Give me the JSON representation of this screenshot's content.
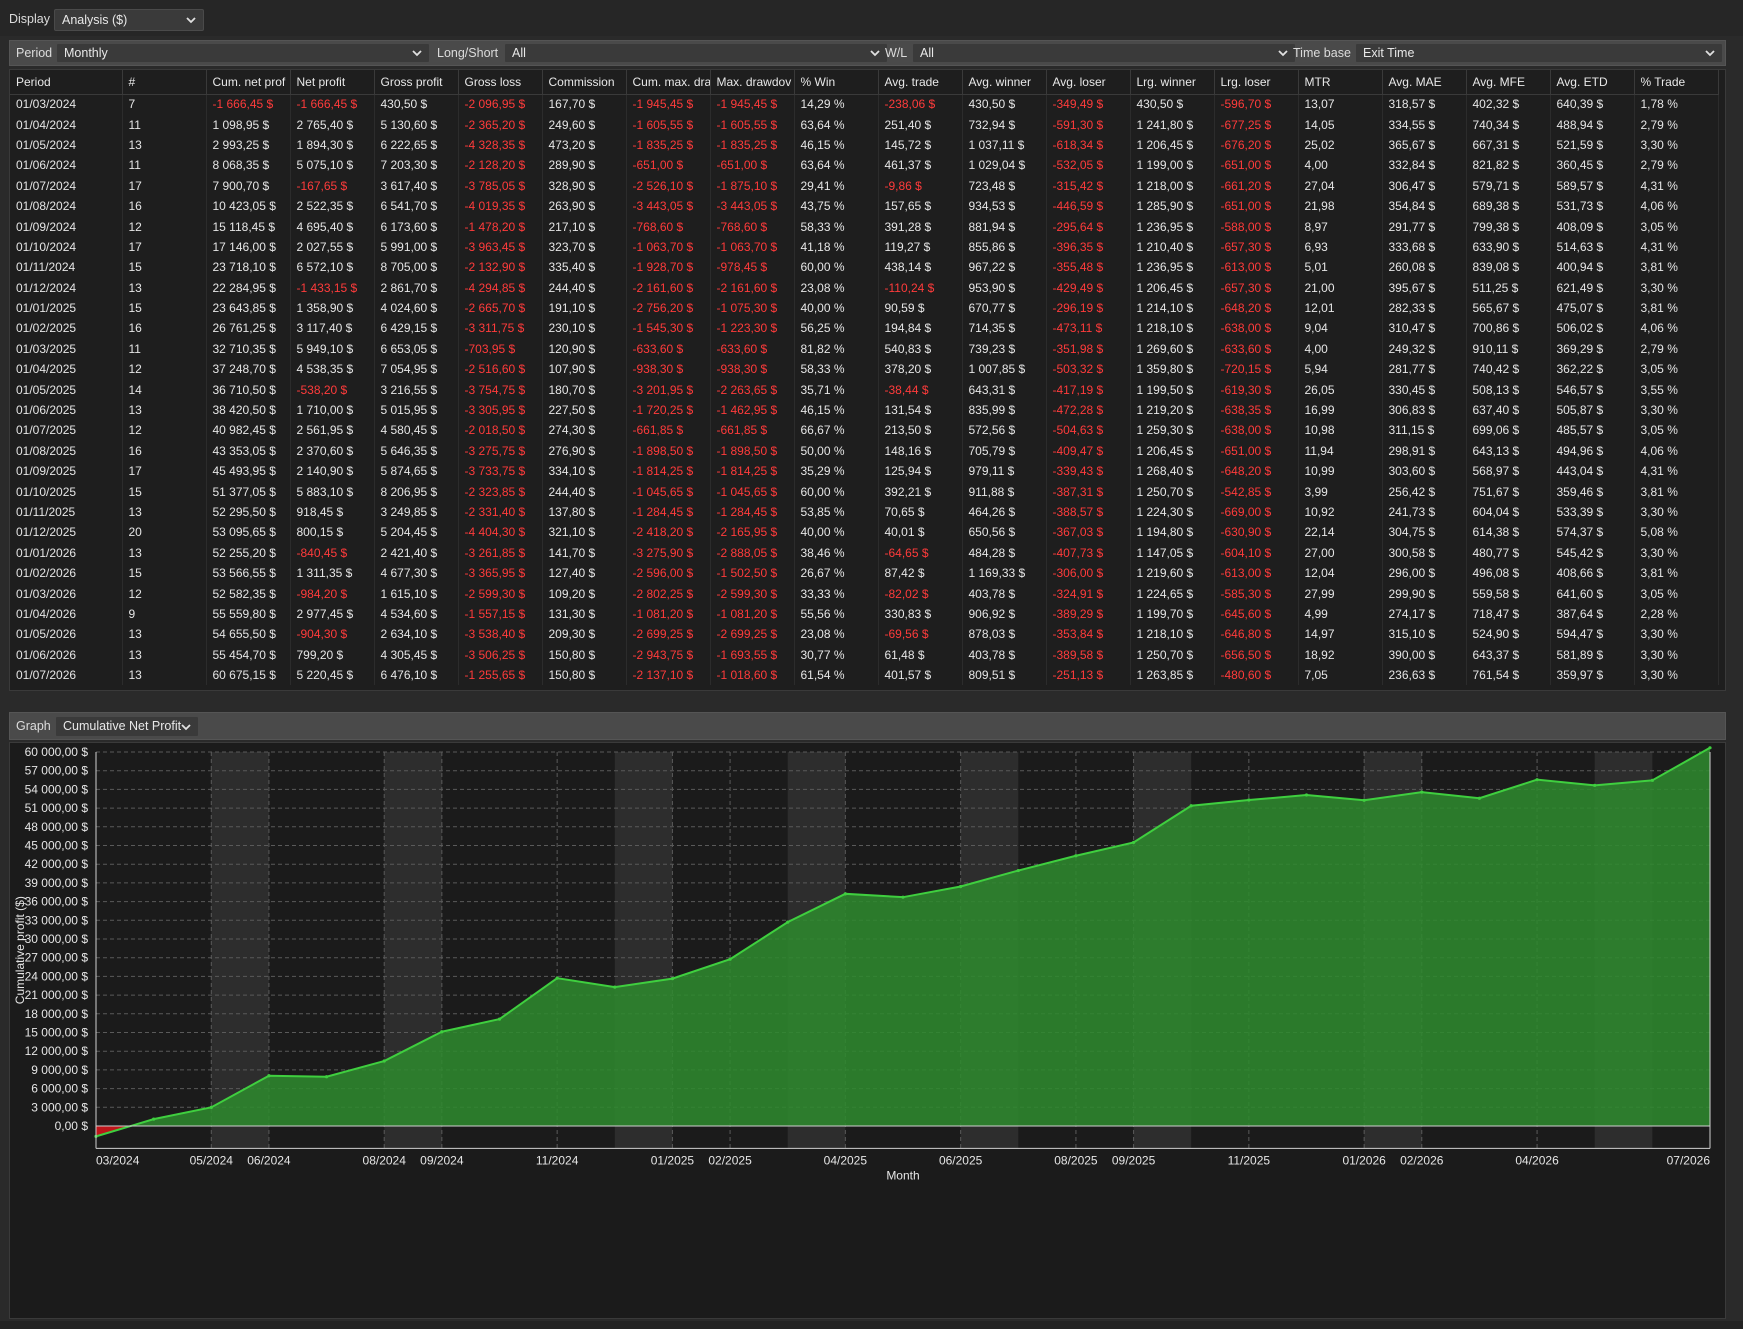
{
  "display": {
    "label": "Display",
    "value": "Analysis ($)"
  },
  "filters": [
    {
      "label": "Period",
      "value": "Monthly"
    },
    {
      "label": "Long/Short",
      "value": "All"
    },
    {
      "label": "W/L",
      "value": "All"
    },
    {
      "label": "Time base",
      "value": "Exit Time"
    }
  ],
  "table": {
    "columns": [
      "Period",
      "#",
      "Cum. net prof",
      "Net profit",
      "Gross profit",
      "Gross loss",
      "Commission",
      "Cum. max. dra",
      "Max. drawdov",
      "% Win",
      "Avg. trade",
      "Avg. winner",
      "Avg. loser",
      "Lrg. winner",
      "Lrg. loser",
      "MTR",
      "Avg. MAE",
      "Avg. MFE",
      "Avg. ETD",
      "% Trade"
    ],
    "rows": [
      [
        "01/03/2024",
        "7",
        "-1 666,45 $",
        "-1 666,45 $",
        "430,50 $",
        "-2 096,95 $",
        "167,70 $",
        "-1 945,45 $",
        "-1 945,45 $",
        "14,29 %",
        "-238,06 $",
        "430,50 $",
        "-349,49 $",
        "430,50 $",
        "-596,70 $",
        "13,07",
        "318,57 $",
        "402,32 $",
        "640,39 $",
        "1,78 %"
      ],
      [
        "01/04/2024",
        "11",
        "1 098,95 $",
        "2 765,40 $",
        "5 130,60 $",
        "-2 365,20 $",
        "249,60 $",
        "-1 605,55 $",
        "-1 605,55 $",
        "63,64 %",
        "251,40 $",
        "732,94 $",
        "-591,30 $",
        "1 241,80 $",
        "-677,25 $",
        "14,05",
        "334,55 $",
        "740,34 $",
        "488,94 $",
        "2,79 %"
      ],
      [
        "01/05/2024",
        "13",
        "2 993,25 $",
        "1 894,30 $",
        "6 222,65 $",
        "-4 328,35 $",
        "473,20 $",
        "-1 835,25 $",
        "-1 835,25 $",
        "46,15 %",
        "145,72 $",
        "1 037,11 $",
        "-618,34 $",
        "1 206,45 $",
        "-676,20 $",
        "25,02",
        "365,67 $",
        "667,31 $",
        "521,59 $",
        "3,30 %"
      ],
      [
        "01/06/2024",
        "11",
        "8 068,35 $",
        "5 075,10 $",
        "7 203,30 $",
        "-2 128,20 $",
        "289,90 $",
        "-651,00 $",
        "-651,00 $",
        "63,64 %",
        "461,37 $",
        "1 029,04 $",
        "-532,05 $",
        "1 199,00 $",
        "-651,00 $",
        "4,00",
        "332,84 $",
        "821,82 $",
        "360,45 $",
        "2,79 %"
      ],
      [
        "01/07/2024",
        "17",
        "7 900,70 $",
        "-167,65 $",
        "3 617,40 $",
        "-3 785,05 $",
        "328,90 $",
        "-2 526,10 $",
        "-1 875,10 $",
        "29,41 %",
        "-9,86 $",
        "723,48 $",
        "-315,42 $",
        "1 218,00 $",
        "-661,20 $",
        "27,04",
        "306,47 $",
        "579,71 $",
        "589,57 $",
        "4,31 %"
      ],
      [
        "01/08/2024",
        "16",
        "10 423,05 $",
        "2 522,35 $",
        "6 541,70 $",
        "-4 019,35 $",
        "263,90 $",
        "-3 443,05 $",
        "-3 443,05 $",
        "43,75 %",
        "157,65 $",
        "934,53 $",
        "-446,59 $",
        "1 285,90 $",
        "-651,00 $",
        "21,98",
        "354,84 $",
        "689,38 $",
        "531,73 $",
        "4,06 %"
      ],
      [
        "01/09/2024",
        "12",
        "15 118,45 $",
        "4 695,40 $",
        "6 173,60 $",
        "-1 478,20 $",
        "217,10 $",
        "-768,60 $",
        "-768,60 $",
        "58,33 %",
        "391,28 $",
        "881,94 $",
        "-295,64 $",
        "1 236,95 $",
        "-588,00 $",
        "8,97",
        "291,77 $",
        "799,38 $",
        "408,09 $",
        "3,05 %"
      ],
      [
        "01/10/2024",
        "17",
        "17 146,00 $",
        "2 027,55 $",
        "5 991,00 $",
        "-3 963,45 $",
        "323,70 $",
        "-1 063,70 $",
        "-1 063,70 $",
        "41,18 %",
        "119,27 $",
        "855,86 $",
        "-396,35 $",
        "1 210,40 $",
        "-657,30 $",
        "6,93",
        "333,68 $",
        "633,90 $",
        "514,63 $",
        "4,31 %"
      ],
      [
        "01/11/2024",
        "15",
        "23 718,10 $",
        "6 572,10 $",
        "8 705,00 $",
        "-2 132,90 $",
        "335,40 $",
        "-1 928,70 $",
        "-978,45 $",
        "60,00 %",
        "438,14 $",
        "967,22 $",
        "-355,48 $",
        "1 236,95 $",
        "-613,00 $",
        "5,01",
        "260,08 $",
        "839,08 $",
        "400,94 $",
        "3,81 %"
      ],
      [
        "01/12/2024",
        "13",
        "22 284,95 $",
        "-1 433,15 $",
        "2 861,70 $",
        "-4 294,85 $",
        "244,40 $",
        "-2 161,60 $",
        "-2 161,60 $",
        "23,08 %",
        "-110,24 $",
        "953,90 $",
        "-429,49 $",
        "1 206,45 $",
        "-657,30 $",
        "21,00",
        "395,67 $",
        "511,25 $",
        "621,49 $",
        "3,30 %"
      ],
      [
        "01/01/2025",
        "15",
        "23 643,85 $",
        "1 358,90 $",
        "4 024,60 $",
        "-2 665,70 $",
        "191,10 $",
        "-2 756,20 $",
        "-1 075,30 $",
        "40,00 %",
        "90,59 $",
        "670,77 $",
        "-296,19 $",
        "1 214,10 $",
        "-648,20 $",
        "12,01",
        "282,33 $",
        "565,67 $",
        "475,07 $",
        "3,81 %"
      ],
      [
        "01/02/2025",
        "16",
        "26 761,25 $",
        "3 117,40 $",
        "6 429,15 $",
        "-3 311,75 $",
        "230,10 $",
        "-1 545,30 $",
        "-1 223,30 $",
        "56,25 %",
        "194,84 $",
        "714,35 $",
        "-473,11 $",
        "1 218,10 $",
        "-638,00 $",
        "9,04",
        "310,47 $",
        "700,86 $",
        "506,02 $",
        "4,06 %"
      ],
      [
        "01/03/2025",
        "11",
        "32 710,35 $",
        "5 949,10 $",
        "6 653,05 $",
        "-703,95 $",
        "120,90 $",
        "-633,60 $",
        "-633,60 $",
        "81,82 %",
        "540,83 $",
        "739,23 $",
        "-351,98 $",
        "1 269,60 $",
        "-633,60 $",
        "4,00",
        "249,32 $",
        "910,11 $",
        "369,29 $",
        "2,79 %"
      ],
      [
        "01/04/2025",
        "12",
        "37 248,70 $",
        "4 538,35 $",
        "7 054,95 $",
        "-2 516,60 $",
        "107,90 $",
        "-938,30 $",
        "-938,30 $",
        "58,33 %",
        "378,20 $",
        "1 007,85 $",
        "-503,32 $",
        "1 359,80 $",
        "-720,15 $",
        "5,94",
        "281,77 $",
        "740,42 $",
        "362,22 $",
        "3,05 %"
      ],
      [
        "01/05/2025",
        "14",
        "36 710,50 $",
        "-538,20 $",
        "3 216,55 $",
        "-3 754,75 $",
        "180,70 $",
        "-3 201,95 $",
        "-2 263,65 $",
        "35,71 %",
        "-38,44 $",
        "643,31 $",
        "-417,19 $",
        "1 199,50 $",
        "-619,30 $",
        "26,05",
        "330,45 $",
        "508,13 $",
        "546,57 $",
        "3,55 %"
      ],
      [
        "01/06/2025",
        "13",
        "38 420,50 $",
        "1 710,00 $",
        "5 015,95 $",
        "-3 305,95 $",
        "227,50 $",
        "-1 720,25 $",
        "-1 462,95 $",
        "46,15 %",
        "131,54 $",
        "835,99 $",
        "-472,28 $",
        "1 219,20 $",
        "-638,35 $",
        "16,99",
        "306,83 $",
        "637,40 $",
        "505,87 $",
        "3,30 %"
      ],
      [
        "01/07/2025",
        "12",
        "40 982,45 $",
        "2 561,95 $",
        "4 580,45 $",
        "-2 018,50 $",
        "274,30 $",
        "-661,85 $",
        "-661,85 $",
        "66,67 %",
        "213,50 $",
        "572,56 $",
        "-504,63 $",
        "1 259,30 $",
        "-638,00 $",
        "10,98",
        "311,15 $",
        "699,06 $",
        "485,57 $",
        "3,05 %"
      ],
      [
        "01/08/2025",
        "16",
        "43 353,05 $",
        "2 370,60 $",
        "5 646,35 $",
        "-3 275,75 $",
        "276,90 $",
        "-1 898,50 $",
        "-1 898,50 $",
        "50,00 %",
        "148,16 $",
        "705,79 $",
        "-409,47 $",
        "1 206,45 $",
        "-651,00 $",
        "11,94",
        "298,91 $",
        "643,13 $",
        "494,96 $",
        "4,06 %"
      ],
      [
        "01/09/2025",
        "17",
        "45 493,95 $",
        "2 140,90 $",
        "5 874,65 $",
        "-3 733,75 $",
        "334,10 $",
        "-1 814,25 $",
        "-1 814,25 $",
        "35,29 %",
        "125,94 $",
        "979,11 $",
        "-339,43 $",
        "1 268,40 $",
        "-648,20 $",
        "10,99",
        "303,60 $",
        "568,97 $",
        "443,04 $",
        "4,31 %"
      ],
      [
        "01/10/2025",
        "15",
        "51 377,05 $",
        "5 883,10 $",
        "8 206,95 $",
        "-2 323,85 $",
        "244,40 $",
        "-1 045,65 $",
        "-1 045,65 $",
        "60,00 %",
        "392,21 $",
        "911,88 $",
        "-387,31 $",
        "1 250,70 $",
        "-542,85 $",
        "3,99",
        "256,42 $",
        "751,67 $",
        "359,46 $",
        "3,81 %"
      ],
      [
        "01/11/2025",
        "13",
        "52 295,50 $",
        "918,45 $",
        "3 249,85 $",
        "-2 331,40 $",
        "137,80 $",
        "-1 284,45 $",
        "-1 284,45 $",
        "53,85 %",
        "70,65 $",
        "464,26 $",
        "-388,57 $",
        "1 224,30 $",
        "-669,00 $",
        "10,92",
        "241,73 $",
        "604,04 $",
        "533,39 $",
        "3,30 %"
      ],
      [
        "01/12/2025",
        "20",
        "53 095,65 $",
        "800,15 $",
        "5 204,45 $",
        "-4 404,30 $",
        "321,10 $",
        "-2 418,20 $",
        "-2 165,95 $",
        "40,00 %",
        "40,01 $",
        "650,56 $",
        "-367,03 $",
        "1 194,80 $",
        "-630,90 $",
        "22,14",
        "304,75 $",
        "614,38 $",
        "574,37 $",
        "5,08 %"
      ],
      [
        "01/01/2026",
        "13",
        "52 255,20 $",
        "-840,45 $",
        "2 421,40 $",
        "-3 261,85 $",
        "141,70 $",
        "-3 275,90 $",
        "-2 888,05 $",
        "38,46 %",
        "-64,65 $",
        "484,28 $",
        "-407,73 $",
        "1 147,05 $",
        "-604,10 $",
        "27,00",
        "300,58 $",
        "480,77 $",
        "545,42 $",
        "3,30 %"
      ],
      [
        "01/02/2026",
        "15",
        "53 566,55 $",
        "1 311,35 $",
        "4 677,30 $",
        "-3 365,95 $",
        "127,40 $",
        "-2 596,00 $",
        "-1 502,50 $",
        "26,67 %",
        "87,42 $",
        "1 169,33 $",
        "-306,00 $",
        "1 219,60 $",
        "-613,00 $",
        "12,04",
        "296,00 $",
        "496,08 $",
        "408,66 $",
        "3,81 %"
      ],
      [
        "01/03/2026",
        "12",
        "52 582,35 $",
        "-984,20 $",
        "1 615,10 $",
        "-2 599,30 $",
        "109,20 $",
        "-2 802,25 $",
        "-2 599,30 $",
        "33,33 %",
        "-82,02 $",
        "403,78 $",
        "-324,91 $",
        "1 224,65 $",
        "-585,30 $",
        "27,99",
        "299,90 $",
        "559,58 $",
        "641,60 $",
        "3,05 %"
      ],
      [
        "01/04/2026",
        "9",
        "55 559,80 $",
        "2 977,45 $",
        "4 534,60 $",
        "-1 557,15 $",
        "131,30 $",
        "-1 081,20 $",
        "-1 081,20 $",
        "55,56 %",
        "330,83 $",
        "906,92 $",
        "-389,29 $",
        "1 199,70 $",
        "-645,60 $",
        "4,99",
        "274,17 $",
        "718,47 $",
        "387,64 $",
        "2,28 %"
      ],
      [
        "01/05/2026",
        "13",
        "54 655,50 $",
        "-904,30 $",
        "2 634,10 $",
        "-3 538,40 $",
        "209,30 $",
        "-2 699,25 $",
        "-2 699,25 $",
        "23,08 %",
        "-69,56 $",
        "878,03 $",
        "-353,84 $",
        "1 218,10 $",
        "-646,80 $",
        "14,97",
        "315,10 $",
        "524,90 $",
        "594,47 $",
        "3,30 %"
      ],
      [
        "01/06/2026",
        "13",
        "55 454,70 $",
        "799,20 $",
        "4 305,45 $",
        "-3 506,25 $",
        "150,80 $",
        "-2 943,75 $",
        "-1 693,55 $",
        "30,77 %",
        "61,48 $",
        "403,78 $",
        "-389,58 $",
        "1 250,70 $",
        "-656,50 $",
        "18,92",
        "390,00 $",
        "643,37 $",
        "581,89 $",
        "3,30 %"
      ],
      [
        "01/07/2026",
        "13",
        "60 675,15 $",
        "5 220,45 $",
        "6 476,10 $",
        "-1 255,65 $",
        "150,80 $",
        "-2 137,10 $",
        "-1 018,60 $",
        "61,54 %",
        "401,57 $",
        "809,51 $",
        "-251,13 $",
        "1 263,85 $",
        "-480,60 $",
        "7,05",
        "236,63 $",
        "761,54 $",
        "359,97 $",
        "3,30 %"
      ]
    ]
  },
  "graph": {
    "label": "Graph",
    "value": "Cumulative Net Profit"
  },
  "chart_data": {
    "type": "area",
    "xlabel": "Month",
    "ylabel": "Cumulative profit ($)",
    "ylim": [
      0,
      60000
    ],
    "y_tick_labels": [
      "0,00 $",
      "3 000,00 $",
      "6 000,00 $",
      "9 000,00 $",
      "12 000,00 $",
      "15 000,00 $",
      "18 000,00 $",
      "21 000,00 $",
      "24 000,00 $",
      "27 000,00 $",
      "30 000,00 $",
      "33 000,00 $",
      "36 000,00 $",
      "39 000,00 $",
      "42 000,00 $",
      "45 000,00 $",
      "48 000,00 $",
      "51 000,00 $",
      "54 000,00 $",
      "57 000,00 $",
      "60 000,00 $"
    ],
    "x_tick_labels": [
      "03/2024",
      "05/2024",
      "06/2024",
      "08/2024",
      "09/2024",
      "11/2024",
      "01/2025",
      "02/2025",
      "04/2025",
      "06/2025",
      "08/2025",
      "09/2025",
      "11/2025",
      "01/2026",
      "02/2026",
      "04/2026",
      "07/2026"
    ],
    "categories": [
      "03/2024",
      "04/2024",
      "05/2024",
      "06/2024",
      "07/2024",
      "08/2024",
      "09/2024",
      "10/2024",
      "11/2024",
      "12/2024",
      "01/2025",
      "02/2025",
      "03/2025",
      "04/2025",
      "05/2025",
      "06/2025",
      "07/2025",
      "08/2025",
      "09/2025",
      "10/2025",
      "11/2025",
      "12/2025",
      "01/2026",
      "02/2026",
      "03/2026",
      "04/2026",
      "05/2026",
      "06/2026",
      "07/2026"
    ],
    "values": [
      -1666.45,
      1098.95,
      2993.25,
      8068.35,
      7900.7,
      10423.05,
      15118.45,
      17146.0,
      23718.1,
      22284.95,
      23643.85,
      26761.25,
      32710.35,
      37248.7,
      36710.5,
      38420.5,
      40982.45,
      43353.05,
      45493.95,
      51377.05,
      52295.5,
      53095.65,
      52255.2,
      53566.55,
      52582.35,
      55559.8,
      54655.5,
      55454.7,
      60675.15
    ],
    "grid": true,
    "colors": {
      "positive_fill": "#2e8b2e",
      "positive_line": "#3fcf3f",
      "negative_fill": "#c0151a",
      "background": "#1b1b1b",
      "band": "#2d2d2d"
    }
  }
}
